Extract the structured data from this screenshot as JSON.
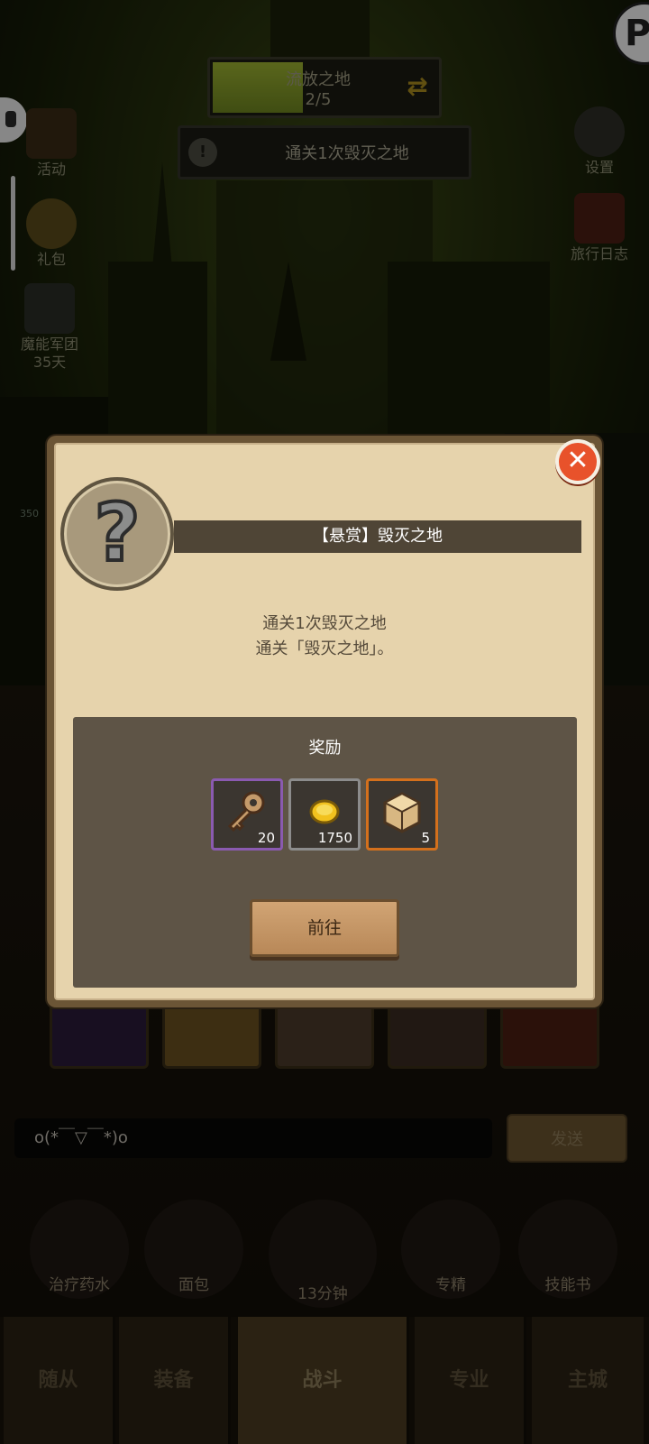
{
  "stage": {
    "name": "流放之地",
    "progress_text": "2/5",
    "progress": 0.4
  },
  "quest_bar": {
    "text": "通关1次毁灭之地"
  },
  "left_menu": [
    {
      "label": "活动"
    },
    {
      "label": "礼包"
    },
    {
      "label": "魔能军团",
      "sub": "35天"
    }
  ],
  "right_menu": [
    {
      "label": "设置"
    },
    {
      "label": "旅行日志"
    }
  ],
  "dialog": {
    "title": "【悬赏】毁灭之地",
    "desc_line1": "通关1次毁灭之地",
    "desc_line2": "通关「毁灭之地」。",
    "reward_title": "奖励",
    "rewards": [
      {
        "icon": "key-icon",
        "count": "20",
        "frame_color": "#8a5ab0"
      },
      {
        "icon": "gold-coin-icon",
        "count": "1750",
        "frame_color": "#8c8c8c"
      },
      {
        "icon": "crate-icon",
        "count": "5",
        "frame_color": "#d4701c"
      }
    ],
    "go_label": "前往",
    "close_label": "✕"
  },
  "side_number": "350",
  "chat": {
    "input_text": "o(*￣▽￣*)o",
    "send_label": "发送"
  },
  "items": [
    {
      "label": "治疗药水"
    },
    {
      "label": "面包"
    },
    {
      "label": "13分钟"
    },
    {
      "label": "专精"
    },
    {
      "label": "技能书"
    }
  ],
  "nav": [
    {
      "label": "随从"
    },
    {
      "label": "装备"
    },
    {
      "label": "战斗"
    },
    {
      "label": "专业"
    },
    {
      "label": "主城"
    }
  ],
  "logo_letter": "P"
}
